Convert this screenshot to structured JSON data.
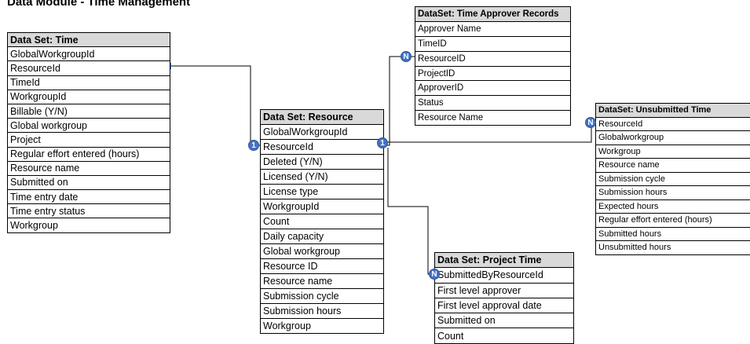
{
  "title": "Data Module - Time Management",
  "tables": {
    "time": {
      "header": "Data Set: Time",
      "fields": [
        "GlobalWorkgroupId",
        "ResourceId",
        "TimeId",
        "WorkgroupId",
        "Billable (Y/N)",
        "Global workgroup",
        "Project",
        "Regular effort entered (hours)",
        "Resource name",
        "Submitted on",
        "Time entry date",
        "Time entry status",
        "Workgroup"
      ]
    },
    "resource": {
      "header": "Data Set: Resource",
      "fields": [
        "GlobalWorkgroupId",
        "ResourceId",
        "Deleted (Y/N)",
        "Licensed (Y/N)",
        "License type",
        "WorkgroupId",
        "Count",
        "Daily capacity",
        "Global workgroup",
        "Resource ID",
        "Resource name",
        "Submission cycle",
        "Submission hours",
        "Workgroup"
      ]
    },
    "approver": {
      "header": "DataSet: Time Approver Records",
      "fields": [
        "Approver Name",
        "TimeID",
        "ResourceID",
        "ProjectID",
        "ApproverID",
        "Status",
        "Resource Name"
      ]
    },
    "unsubmitted": {
      "header": "DataSet: Unsubmitted Time",
      "fields": [
        "ResourceId",
        "Globalworkgroup",
        "Workgroup",
        "Resource name",
        "Submission cycle",
        "Submission hours",
        "Expected hours",
        "Regular effort entered (hours)",
        "Submitted hours",
        "Unsubmitted hours"
      ]
    },
    "project": {
      "header": "Data Set: Project Time",
      "fields": [
        "SubmittedByResourceId",
        "First level approver",
        "First level approval date",
        "Submitted on",
        "Count"
      ]
    }
  },
  "badges": {
    "one": "1",
    "many": "N"
  }
}
